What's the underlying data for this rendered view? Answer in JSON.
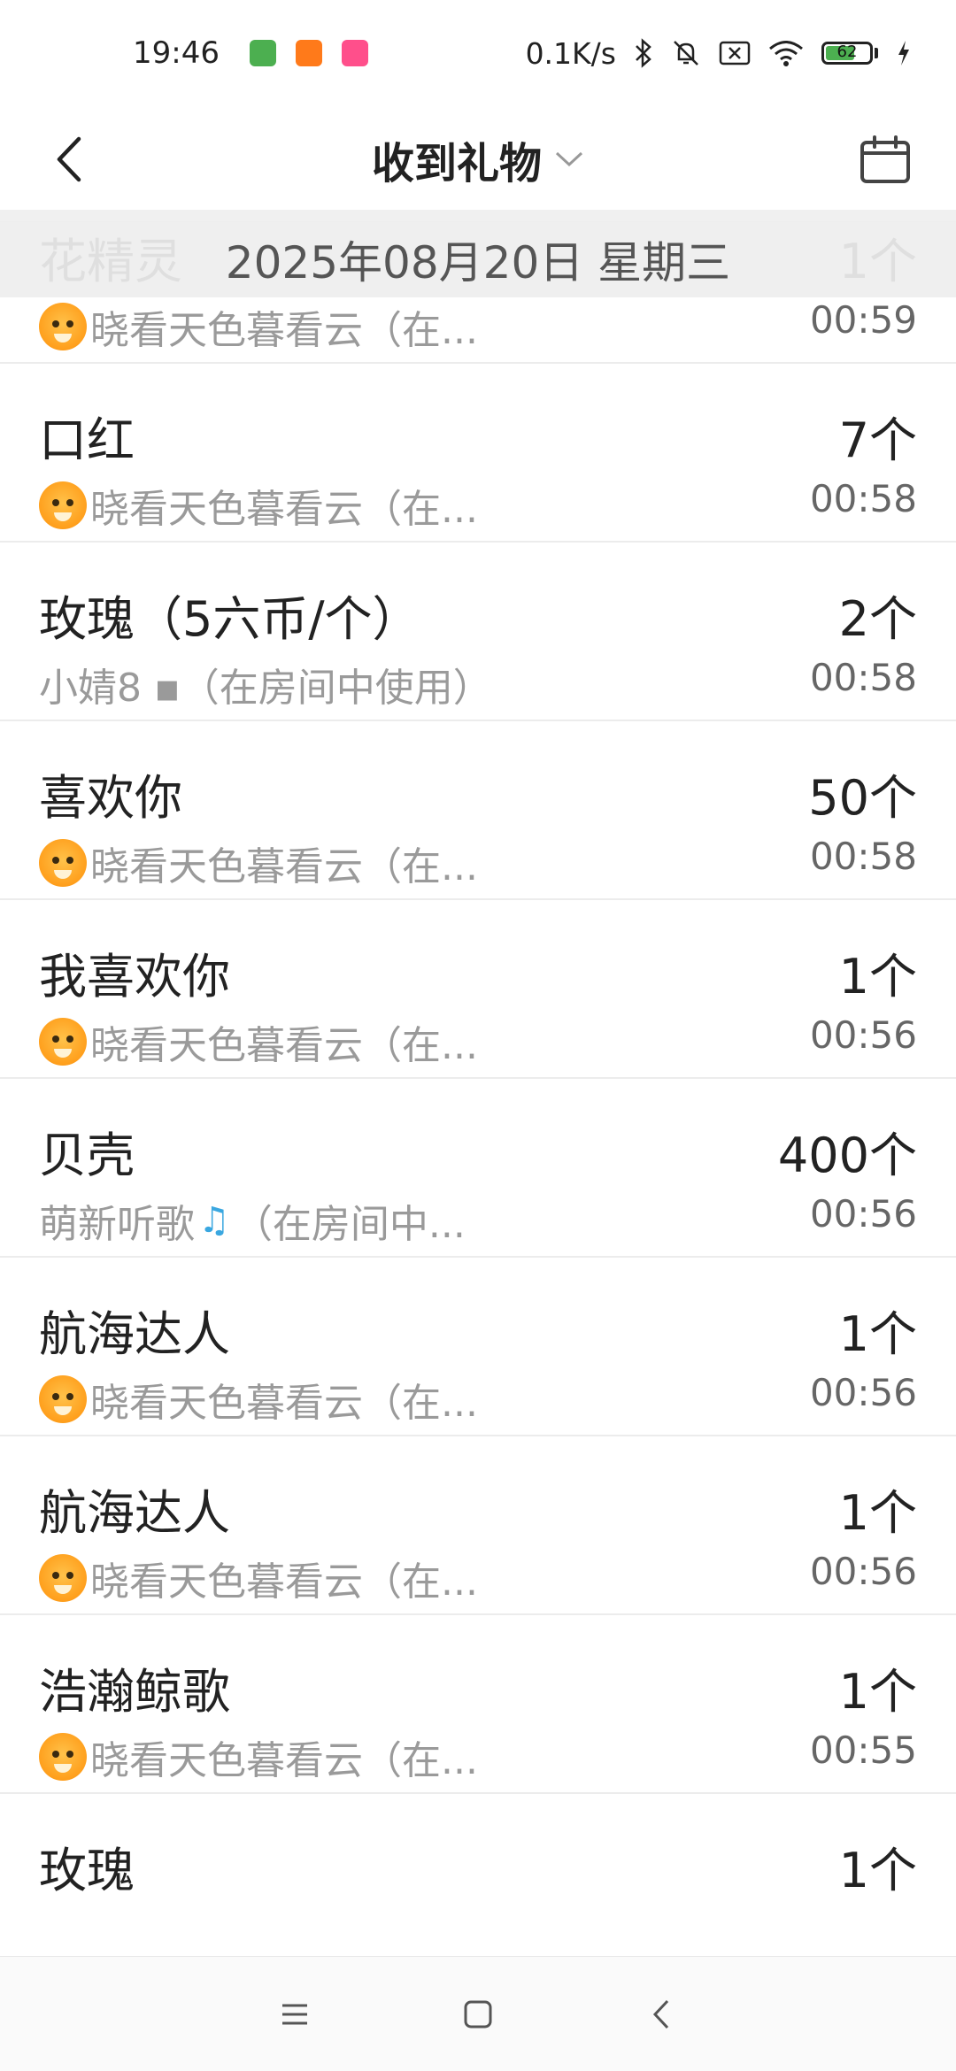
{
  "status_bar": {
    "time": "19:46",
    "network_speed": "0.1K/s",
    "battery_level": "62",
    "battery_fraction": 0.62,
    "battery_color": "#4caf50",
    "icons": [
      "app-notification-icon",
      "app-notification-icon",
      "app-notification-icon",
      "bluetooth-icon",
      "mute-icon",
      "sim-off-icon",
      "wifi-icon",
      "battery-icon",
      "charging-icon"
    ]
  },
  "header": {
    "title": "收到礼物"
  },
  "date_header": "2025年08月20日 星期三",
  "gifts": [
    {
      "name": "花精灵",
      "count": "1个",
      "sender": "晓看天色暮看云（在...",
      "time": "00:59",
      "sender_icon": "tiger"
    },
    {
      "name": "口红",
      "count": "7个",
      "sender": "晓看天色暮看云（在...",
      "time": "00:58",
      "sender_icon": "tiger"
    },
    {
      "name": "玫瑰（5六币/个）",
      "count": "2个",
      "sender": "小婧8 ▪（在房间中使用）",
      "time": "00:58",
      "sender_icon": ""
    },
    {
      "name": "喜欢你",
      "count": "50个",
      "sender": "晓看天色暮看云（在...",
      "time": "00:58",
      "sender_icon": "tiger"
    },
    {
      "name": "我喜欢你",
      "count": "1个",
      "sender": "晓看天色暮看云（在...",
      "time": "00:56",
      "sender_icon": "tiger"
    },
    {
      "name": "贝壳",
      "count": "400个",
      "sender_prefix": "萌新听歌",
      "sender": "（在房间中...",
      "time": "00:56",
      "sender_icon": "music-note"
    },
    {
      "name": "航海达人",
      "count": "1个",
      "sender": "晓看天色暮看云（在...",
      "time": "00:56",
      "sender_icon": "tiger"
    },
    {
      "name": "航海达人",
      "count": "1个",
      "sender": "晓看天色暮看云（在...",
      "time": "00:56",
      "sender_icon": "tiger"
    },
    {
      "name": "浩瀚鲸歌",
      "count": "1个",
      "sender": "晓看天色暮看云（在...",
      "time": "00:55",
      "sender_icon": "tiger"
    },
    {
      "name": "玫瑰",
      "count": "1个",
      "sender": "",
      "time": "",
      "sender_icon": ""
    }
  ]
}
